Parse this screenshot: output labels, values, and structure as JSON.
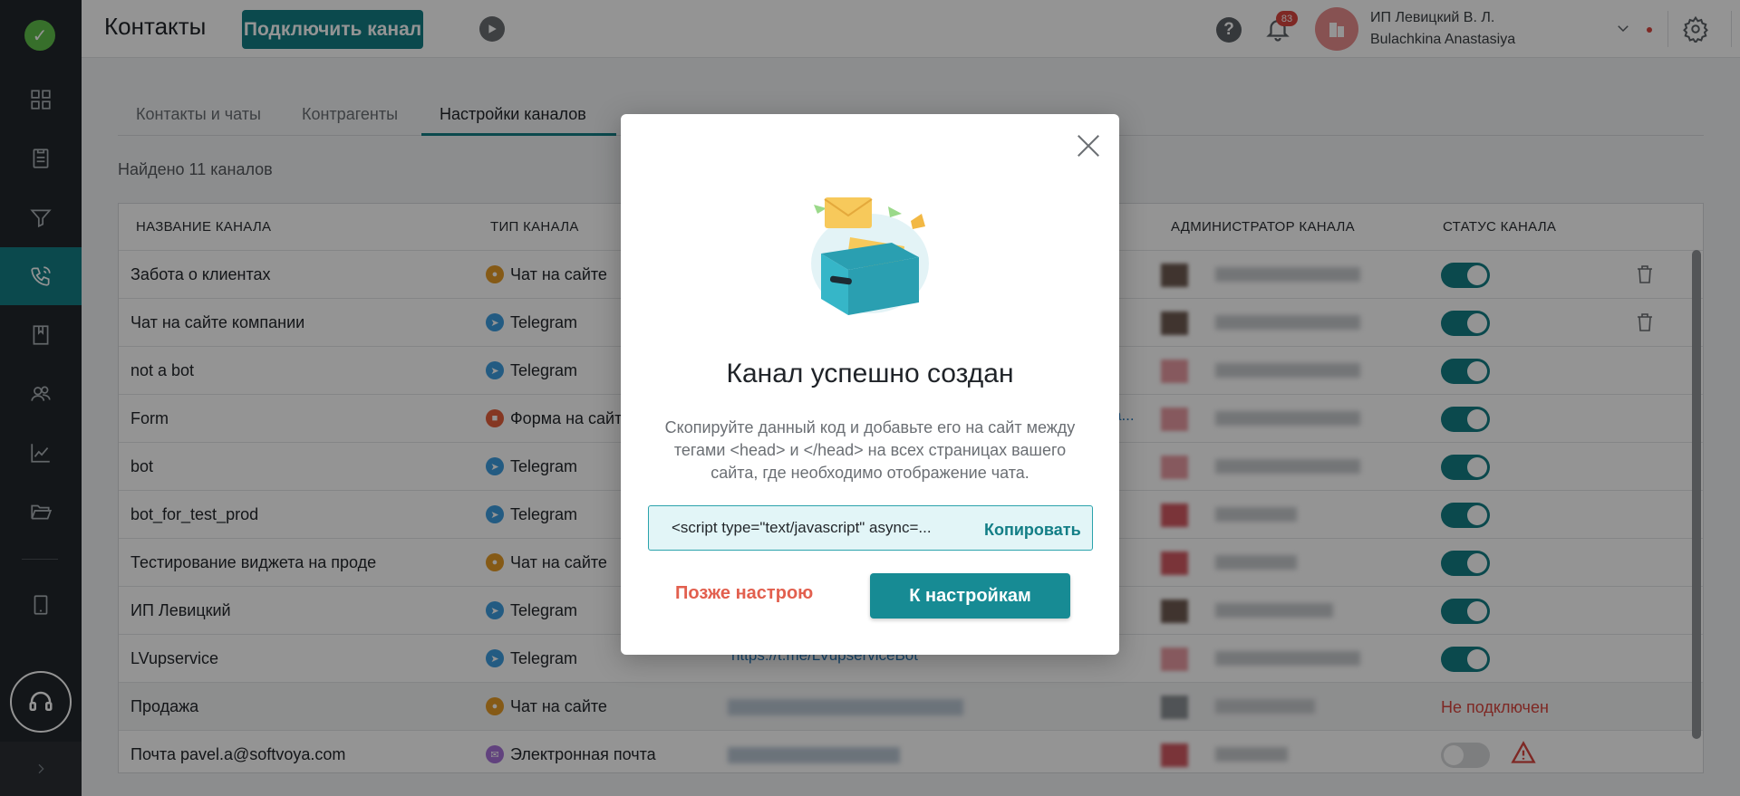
{
  "header": {
    "title": "Контакты",
    "connect_label": "Подключить канал",
    "notifications_count": "83",
    "user_line1": "ИП Левицкий В. Л.",
    "user_line2": "Bulachkina Anastasiya"
  },
  "tabs": [
    {
      "label": "Контакты и чаты"
    },
    {
      "label": "Контрагенты"
    },
    {
      "label": "Настройки каналов"
    }
  ],
  "found_text": "Найдено 11 каналов",
  "table": {
    "headers": {
      "name": "НАЗВАНИЕ КАНАЛА",
      "type": "ТИП КАНАЛА",
      "admin": "АДМИНИСТРАТОР КАНАЛА",
      "status": "СТАТУС КАНАЛА"
    },
    "rows": [
      {
        "name": "Забота о клиентах",
        "type": "Чат на сайте"
      },
      {
        "name": "Чат на сайте компании",
        "type": "Telegram"
      },
      {
        "name": "not a bot",
        "type": "Telegram"
      },
      {
        "name": "Form",
        "type": "Форма на сайте"
      },
      {
        "name": "bot",
        "type": "Telegram"
      },
      {
        "name": "bot_for_test_prod",
        "type": "Telegram"
      },
      {
        "name": "Тестирование виджета на проде",
        "type": "Чат на сайте"
      },
      {
        "name": "ИП Левицкий",
        "type": "Telegram"
      },
      {
        "name": "LVupservice",
        "type": "Telegram",
        "link": "https://t.me/LVupserviceBot"
      },
      {
        "name": "Продажа",
        "type": "Чат на сайте",
        "status": "Не подключен"
      },
      {
        "name": "Почта pavel.a@softvoya.com",
        "type": "Электронная почта"
      }
    ],
    "form_link_fragment": "а..."
  },
  "modal": {
    "title": "Канал успешно создан",
    "description": "Скопируйте данный код и добавьте его на сайт между тегами <head> и </head> на всех страницах вашего сайта, где необходимо отображение чата.",
    "code": "<script type=\"text/javascript\" async=...",
    "copy_label": "Копировать",
    "later_label": "Позже настрою",
    "settings_label": "К настройкам"
  }
}
